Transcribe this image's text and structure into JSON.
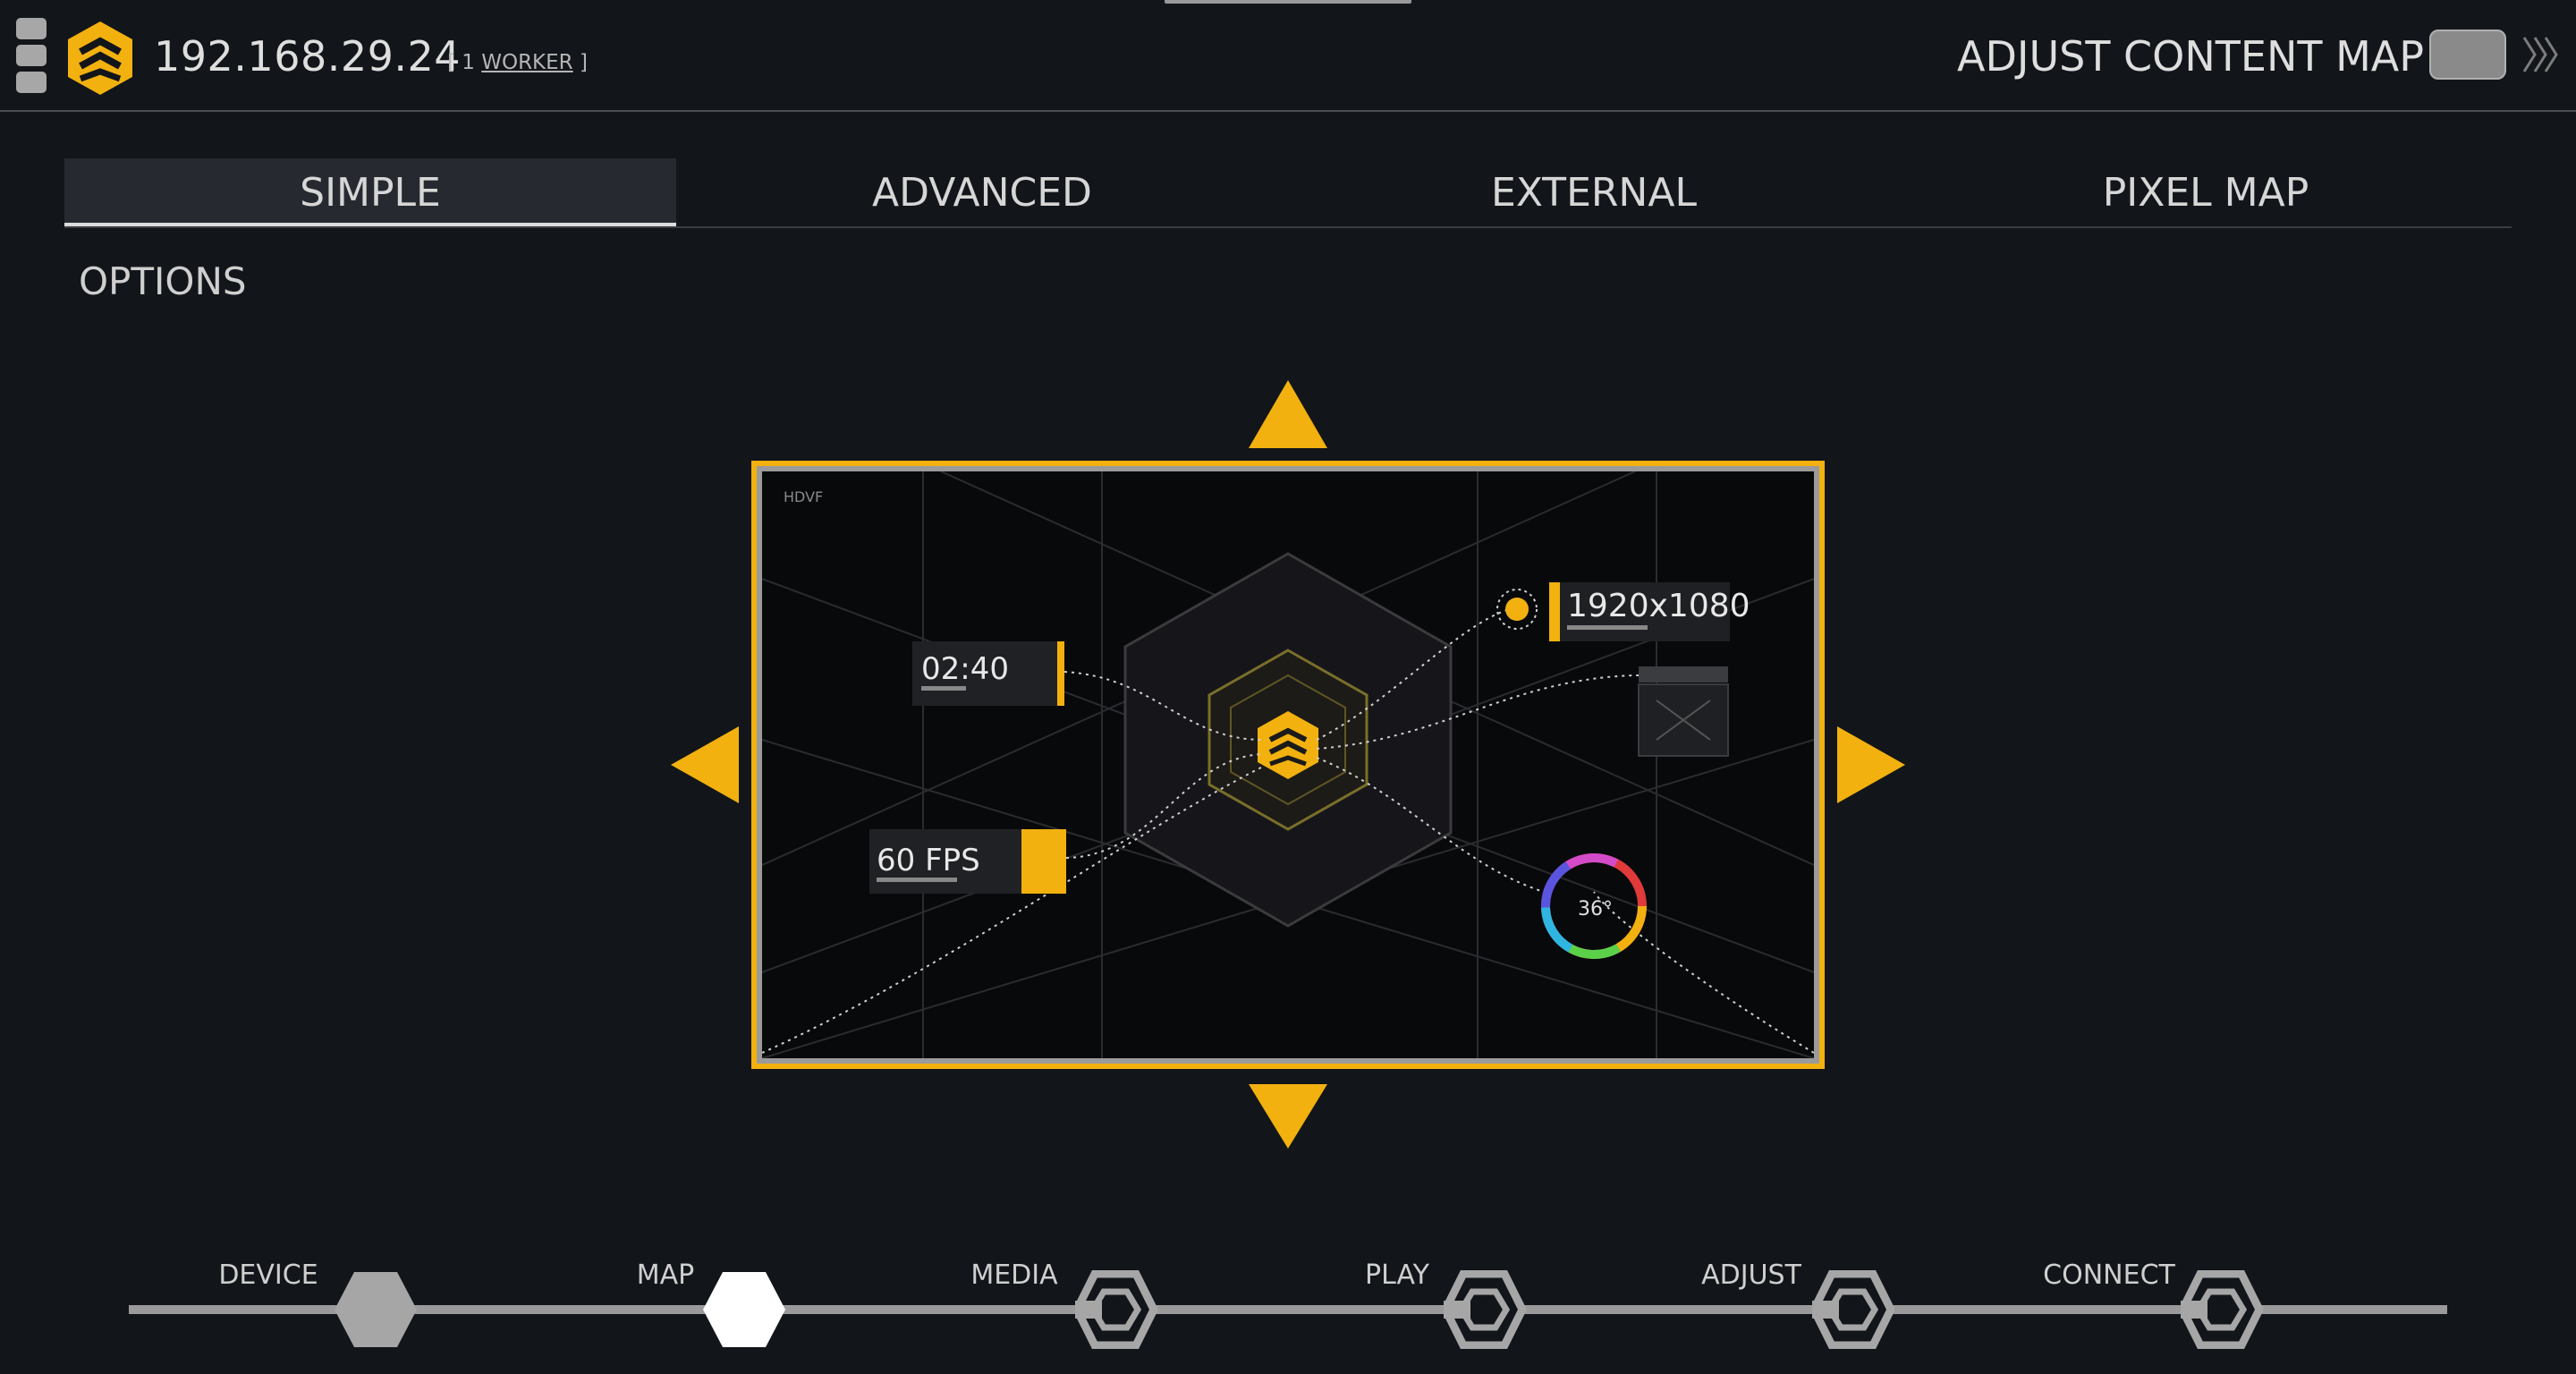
{
  "header": {
    "ip_address": "192.168.29.24",
    "worker_prefix": "[ 1",
    "worker_link": "WORKER",
    "worker_suffix": "]",
    "screen_title": "ADJUST CONTENT MAP",
    "toggle_state": "off"
  },
  "tabs": [
    {
      "label": "SIMPLE",
      "active": true
    },
    {
      "label": "ADVANCED",
      "active": false
    },
    {
      "label": "EXTERNAL",
      "active": false
    },
    {
      "label": "PIXEL MAP",
      "active": false
    }
  ],
  "options_label": "OPTIONS",
  "preview": {
    "corner_text": "HDVF",
    "time_value": "02:40",
    "fps_value": "60 FPS",
    "resolution_value": "1920x1080",
    "angle_value": "36°"
  },
  "workflow": {
    "steps": [
      {
        "label": "DEVICE",
        "state": "done"
      },
      {
        "label": "MAP",
        "state": "current"
      },
      {
        "label": "MEDIA",
        "state": "pending"
      },
      {
        "label": "PLAY",
        "state": "pending"
      },
      {
        "label": "ADJUST",
        "state": "pending"
      },
      {
        "label": "CONNECT",
        "state": "pending"
      }
    ]
  },
  "colors": {
    "accent": "#f2b10f",
    "background": "#12151a",
    "step_done": "#a6a6a6",
    "step_current": "#ffffff"
  }
}
